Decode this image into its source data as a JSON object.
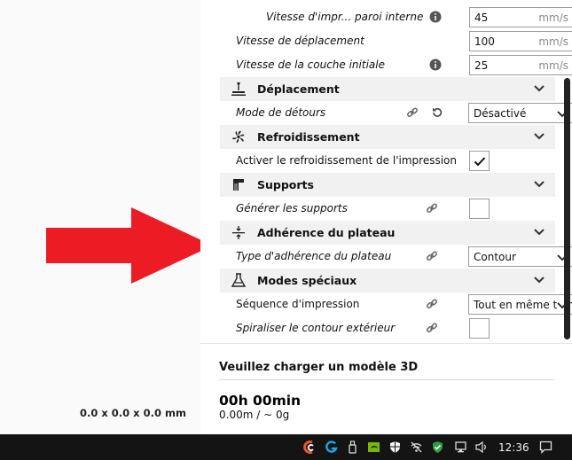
{
  "viewer": {
    "dimensions": "0.0 x 0.0 x 0.0 mm"
  },
  "settings": {
    "speed_wall_inner": {
      "label": "Vitesse d'impr... paroi interne",
      "value": "45",
      "unit": "mm/s"
    },
    "speed_travel": {
      "label": "Vitesse de déplacement",
      "value": "100",
      "unit": "mm/s"
    },
    "speed_initial_layer": {
      "label": "Vitesse de la couche initiale",
      "value": "25",
      "unit": "mm/s"
    },
    "cat_travel": {
      "title": "Déplacement"
    },
    "combing": {
      "label": "Mode de détours",
      "value": "Désactivé"
    },
    "cat_cooling": {
      "title": "Refroidissement"
    },
    "cooling_enable": {
      "label": "Activer le refroidissement de l'impression",
      "checked": true
    },
    "cat_support": {
      "title": "Supports"
    },
    "support_enable": {
      "label": "Générer les supports",
      "checked": false
    },
    "cat_adhesion": {
      "title": "Adhérence du plateau"
    },
    "adhesion_type": {
      "label": "Type d'adhérence du plateau",
      "value": "Contour"
    },
    "cat_special": {
      "title": "Modes spéciaux"
    },
    "print_sequence": {
      "label": "Séquence d'impression",
      "value": "Tout en même temps"
    },
    "spiralize": {
      "label": "Spiraliser le contour extérieur",
      "checked": false
    }
  },
  "summary": {
    "message": "Veuillez charger un modèle 3D",
    "time": "00h 00min",
    "material": "0.00m / ~ 0g"
  },
  "taskbar": {
    "clock": "12:36"
  },
  "colors": {
    "accent_arrow": "#ed1c24",
    "taskbar": "#141414",
    "category_bg": "#f1f1f1"
  }
}
